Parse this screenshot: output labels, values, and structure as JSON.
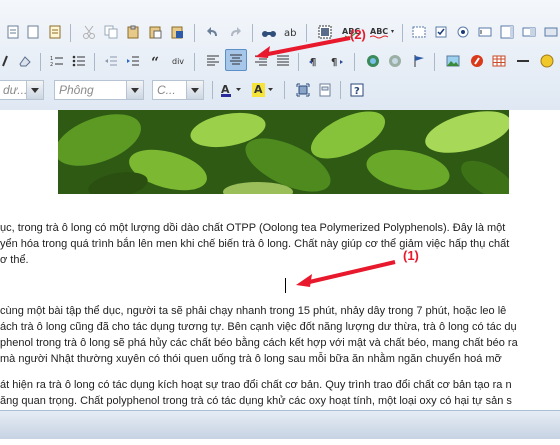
{
  "toolbar": {
    "font_name_placeholder": "dư...",
    "font_face_placeholder": "Phông",
    "font_size_placeholder": "C..."
  },
  "content": {
    "paragraphs": [
      "ục, trong trà ô long có một lượng dồi dào chất OTPP (Oolong tea Polymerized Polyphenols). Đây là một",
      "yển hóa trong quá trình bắn lên men khi chế biến trà ô long. Chất này giúp cơ thể giảm việc hấp thụ chất",
      "ơ thể.",
      "cùng một bài tập thể dục, người ta sẽ phải chạy nhanh trong 15 phút, nhảy dây trong 7 phút, hoặc leo lê",
      "ách trà ô long cũng đã cho tác dụng tương tự. Bên cạnh việc đốt năng lượng dư thừa, trà ô long có tác dụ",
      "phenol trong trà ô long sẽ phá hủy các chất béo bằng cách kết hợp với mật và chất béo, mang chất béo ra",
      "mà người Nhật thường xuyên có thói quen uống trà ô long sau mỗi bữa ăn nhằm ngăn chuyển hoá mỡ",
      "át hiện ra trà ô long có tác dụng kích hoạt sự trao đổi chất cơ bản. Quy trình trao đổi chất cơ bản tạo ra n",
      "ăng quan trọng. Chất polyphenol trong trà có tác dụng khử các oxy hoạt tính, một loại oxy có hại tự sản s"
    ]
  },
  "annotations": {
    "label_1": "(1)",
    "label_2": "(2)"
  },
  "colors": {
    "annotation": "#e8192c",
    "toolbar_bg": "#dfe8f3",
    "active_button": "#a6c6ea"
  }
}
